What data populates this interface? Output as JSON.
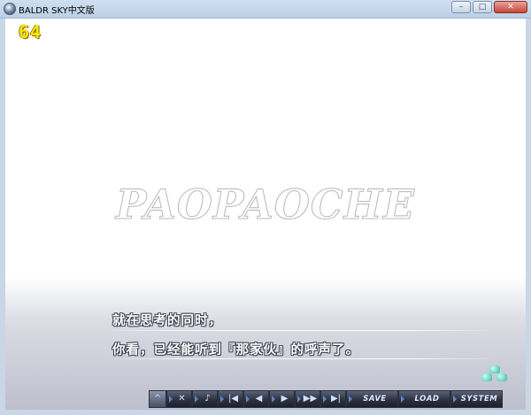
{
  "window": {
    "title": "BALDR SKY中文版",
    "minimize_label": "–",
    "maximize_label": "□",
    "close_label": "✕"
  },
  "game": {
    "counter": "64",
    "watermark": "PAOPAOCHE",
    "dialog": {
      "line1": "就在思考的同时，",
      "line2": "你看，已经能听到『那家伙』的呼声了。"
    }
  },
  "controls": {
    "up": "^",
    "close": "✕",
    "voice": "♪",
    "skip_back": "|◀",
    "back": "◀",
    "forward": "▶",
    "fast_forward": "▶▶",
    "skip_forward": "▶|",
    "save": "SAVE",
    "load": "LOAD",
    "system": "SYSTEM"
  },
  "colors": {
    "counter": "#ffe600",
    "wait_icon": "#39b6a4",
    "control_text": "#cfe1ff"
  }
}
